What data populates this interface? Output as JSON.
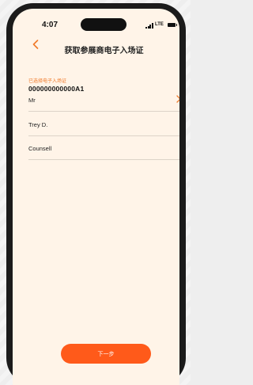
{
  "status_bar": {
    "time": "4:07",
    "network": "LTE"
  },
  "header": {
    "title": "获取参展商电子入场证",
    "back_icon": "chevron-left-icon"
  },
  "selected_badge": {
    "label": "已选择电子入场证",
    "value": "000000000000A1"
  },
  "form": {
    "title_field": {
      "value": "Mr",
      "icon": "chevron-right-icon"
    },
    "name_field": {
      "value": "Trey D."
    },
    "position_field": {
      "value": "Counsell"
    }
  },
  "actions": {
    "next_label": "下一步"
  },
  "colors": {
    "accent": "#ff5a1a",
    "background": "#fff4e8"
  }
}
